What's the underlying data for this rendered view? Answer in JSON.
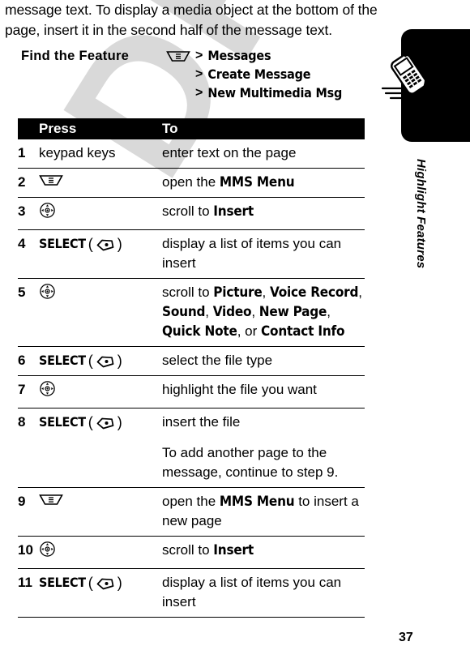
{
  "page": {
    "number": "37",
    "watermark": "DRAFT",
    "sidebar_label": "Highlight Features"
  },
  "intro": {
    "text": "message text. To display a media object at the bottom of the page, insert it in the second half of the message text."
  },
  "find_feature": {
    "title": "Find the Feature",
    "path": [
      {
        "icon": "menu-icon",
        "separator": "",
        "label": "Messages",
        "has_icon": true
      },
      {
        "icon": "",
        "separator": ">",
        "label": "Create Message",
        "has_icon": false
      },
      {
        "icon": "",
        "separator": ">",
        "label": "New Multimedia Msg",
        "has_icon": false
      }
    ],
    "first_separator": ">"
  },
  "table": {
    "headers": {
      "num": "",
      "press": "Press",
      "to": "To"
    },
    "rows": [
      {
        "num": "1",
        "press_type": "text",
        "press_text": "keypad keys",
        "to_parts": [
          [
            {
              "t": "enter text on the page",
              "b": false
            }
          ]
        ]
      },
      {
        "num": "2",
        "press_type": "menu-icon",
        "press_text": "",
        "to_parts": [
          [
            {
              "t": "open the ",
              "b": false
            },
            {
              "t": "MMS Menu",
              "b": true
            }
          ]
        ]
      },
      {
        "num": "3",
        "press_type": "nav-icon",
        "press_text": "",
        "to_parts": [
          [
            {
              "t": "scroll to ",
              "b": false
            },
            {
              "t": "Insert",
              "b": true
            }
          ]
        ]
      },
      {
        "num": "4",
        "press_type": "select-key",
        "press_text": "SELECT",
        "to_parts": [
          [
            {
              "t": "display a list of items you can insert",
              "b": false
            }
          ]
        ]
      },
      {
        "num": "5",
        "press_type": "nav-icon",
        "press_text": "",
        "to_parts": [
          [
            {
              "t": "scroll to ",
              "b": false
            },
            {
              "t": "Picture",
              "b": true
            },
            {
              "t": ", ",
              "b": false
            },
            {
              "t": "Voice Record",
              "b": true
            },
            {
              "t": ", ",
              "b": false
            },
            {
              "t": "Sound",
              "b": true
            },
            {
              "t": ", ",
              "b": false
            },
            {
              "t": "Video",
              "b": true
            },
            {
              "t": ", ",
              "b": false
            },
            {
              "t": "New Page",
              "b": true
            },
            {
              "t": ", ",
              "b": false
            },
            {
              "t": "Quick Note",
              "b": true
            },
            {
              "t": ", or ",
              "b": false
            },
            {
              "t": "Contact Info",
              "b": true
            }
          ]
        ]
      },
      {
        "num": "6",
        "press_type": "select-key",
        "press_text": "SELECT",
        "to_parts": [
          [
            {
              "t": "select the file type",
              "b": false
            }
          ]
        ]
      },
      {
        "num": "7",
        "press_type": "nav-icon",
        "press_text": "",
        "to_parts": [
          [
            {
              "t": "highlight the file you want",
              "b": false
            }
          ]
        ]
      },
      {
        "num": "8",
        "press_type": "select-key",
        "press_text": "SELECT",
        "to_parts": [
          [
            {
              "t": "insert the file",
              "b": false
            }
          ],
          [
            {
              "t": "To add another page to the message, continue to step 9.",
              "b": false
            }
          ]
        ]
      },
      {
        "num": "9",
        "press_type": "menu-icon",
        "press_text": "",
        "to_parts": [
          [
            {
              "t": "open the ",
              "b": false
            },
            {
              "t": "MMS Menu",
              "b": true
            },
            {
              "t": " to insert a new page",
              "b": false
            }
          ]
        ]
      },
      {
        "num": "10",
        "press_type": "nav-icon",
        "press_text": "",
        "to_parts": [
          [
            {
              "t": "scroll to ",
              "b": false
            },
            {
              "t": "Insert",
              "b": true
            }
          ]
        ]
      },
      {
        "num": "11",
        "press_type": "select-key",
        "press_text": "SELECT",
        "to_parts": [
          [
            {
              "t": "display a list of items you can insert",
              "b": false
            }
          ]
        ]
      }
    ]
  },
  "colors": {
    "header_bg": "#000000",
    "header_fg": "#ffffff",
    "watermark": "#d9d9d9",
    "rule": "#000000"
  }
}
